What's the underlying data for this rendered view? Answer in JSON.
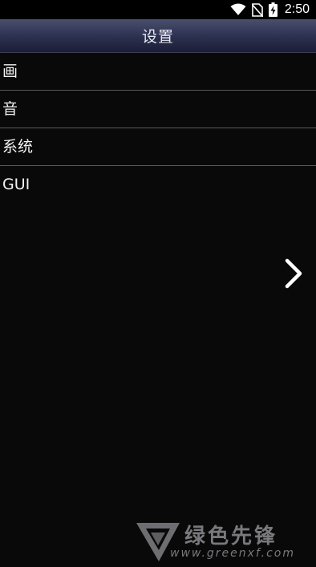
{
  "status_bar": {
    "time": "2:50",
    "icons": [
      "wifi-icon",
      "no-sim-icon",
      "battery-charging-icon"
    ]
  },
  "header": {
    "title": "设置"
  },
  "menu": {
    "items": [
      {
        "label": "画"
      },
      {
        "label": "音"
      },
      {
        "label": "系统"
      },
      {
        "label": "GUI"
      }
    ]
  },
  "navigation": {
    "next_icon": "chevron-right-icon"
  },
  "watermark": {
    "brand": "绿色先锋",
    "url": "www.greenxf.com"
  },
  "colors": {
    "background": "#090909",
    "title_bar": "#2c3050",
    "divider": "#5a5a5a",
    "text": "#f2f2f2",
    "watermark": "#8d8d92"
  }
}
